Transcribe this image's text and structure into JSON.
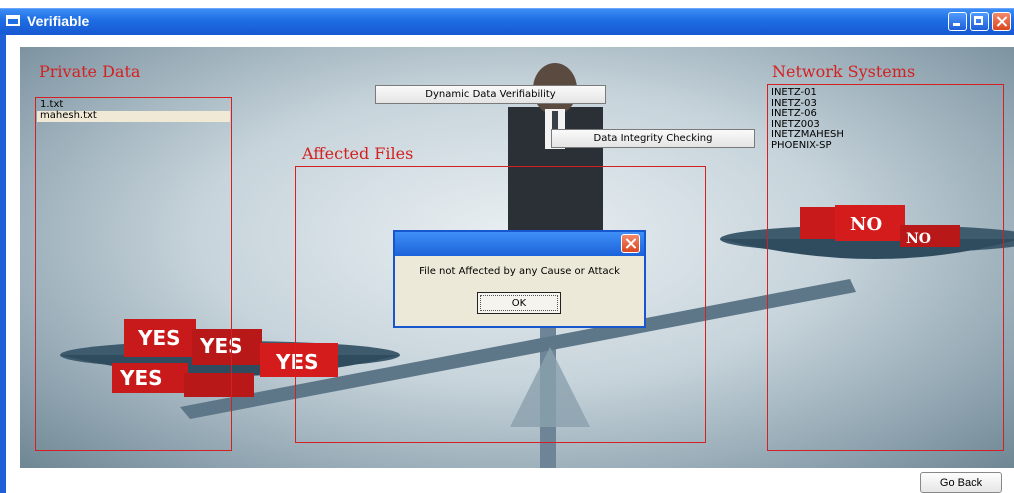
{
  "window": {
    "title": "Verifiable"
  },
  "private_data": {
    "heading": "Private Data",
    "files": [
      "1.txt",
      "mahesh.txt"
    ],
    "selected_index": 1
  },
  "affected_files": {
    "heading": "Affected Files"
  },
  "network_systems": {
    "heading": "Network Systems",
    "items": [
      "INETZ-01",
      "INETZ-03",
      "INETZ-06",
      "INETZ003",
      "INETZMAHESH",
      "PHOENIX-SP"
    ]
  },
  "buttons": {
    "dynamic": "Dynamic Data Verifiability",
    "integrity": "Data Integrity Checking",
    "go_back": "Go Back"
  },
  "dialog": {
    "message": "File not Affected by any Cause or Attack",
    "ok": "OK"
  },
  "scene_labels": {
    "yes": "YES",
    "no": "NO"
  },
  "colors": {
    "accent_red": "#d42020",
    "titlebar_blue": "#1f6fe4"
  }
}
